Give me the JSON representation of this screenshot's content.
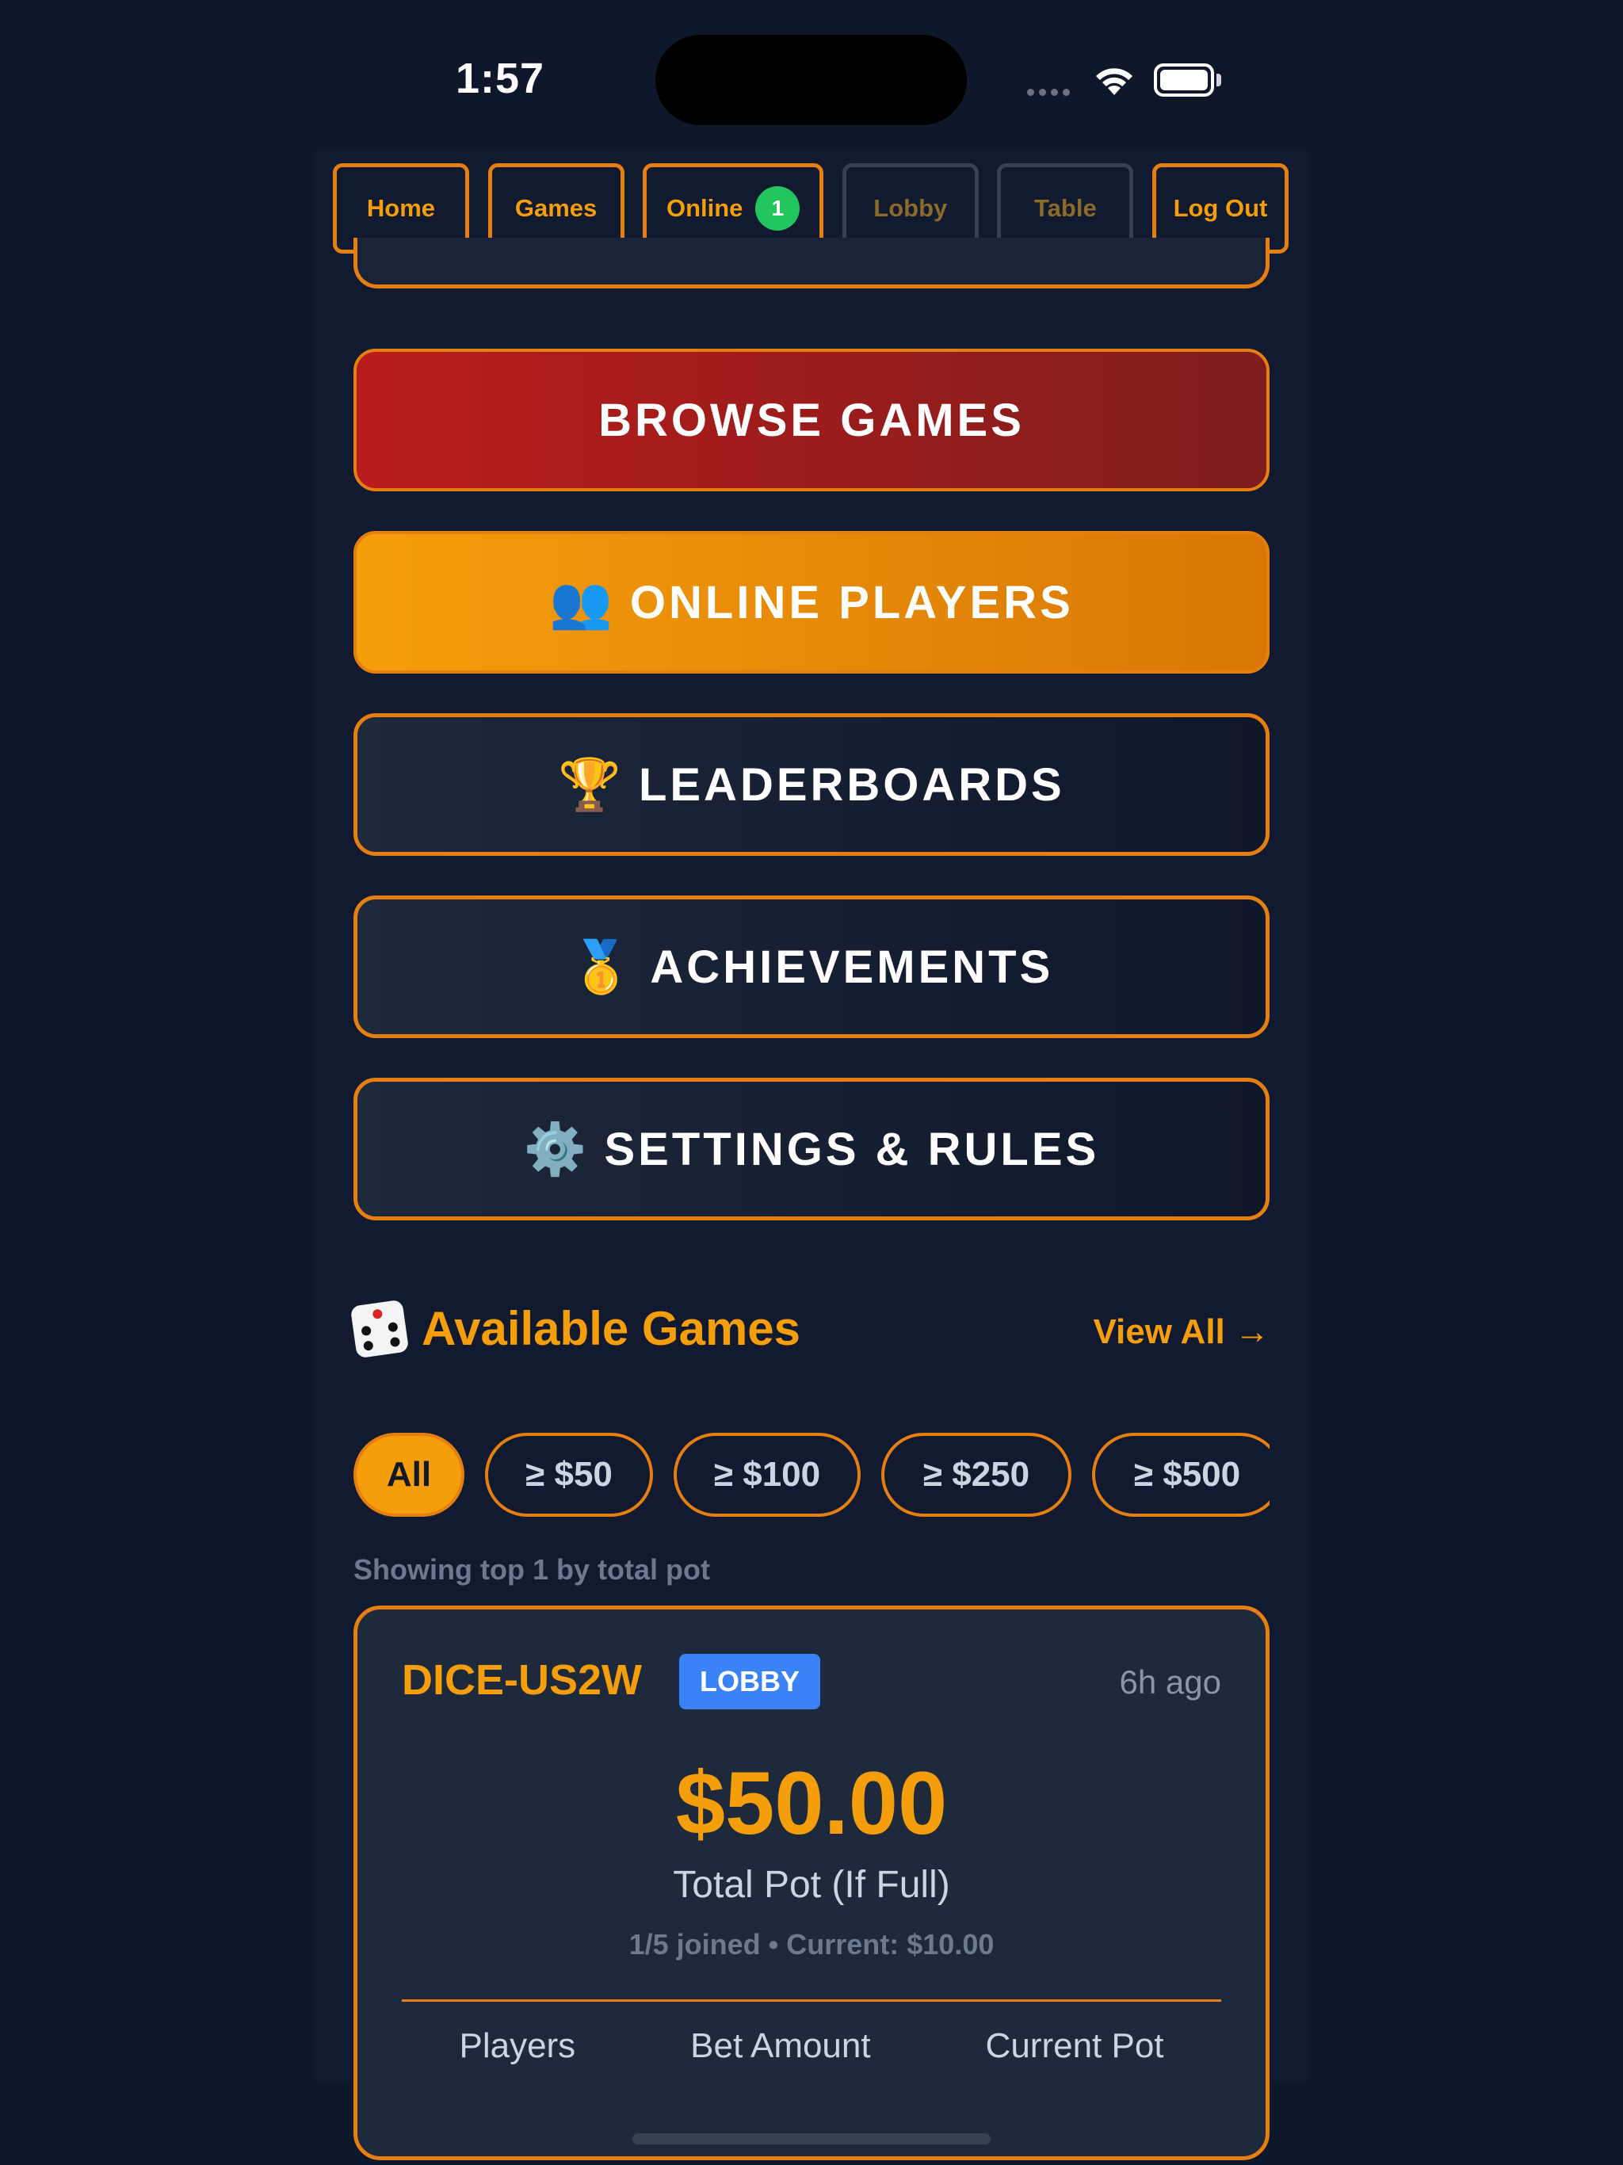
{
  "status": {
    "time": "1:57"
  },
  "nav": {
    "home": "Home",
    "games": "Games",
    "online": "Online",
    "online_badge": "1",
    "lobby": "Lobby",
    "table": "Table",
    "logout": "Log Out"
  },
  "menu": {
    "browse": "BROWSE GAMES",
    "online_players": "ONLINE PLAYERS",
    "leaderboards": "LEADERBOARDS",
    "achievements": "ACHIEVEMENTS",
    "settings": "SETTINGS & RULES",
    "icons": {
      "online_players": "👥",
      "leaderboards": "🏆",
      "achievements": "🥇",
      "settings": "⚙️"
    }
  },
  "available": {
    "title": "Available Games",
    "view_all": "View All →",
    "filters": [
      "All",
      "≥ $50",
      "≥ $100",
      "≥ $250",
      "≥ $500"
    ],
    "active_filter": "All",
    "showing": "Showing top 1 by total pot"
  },
  "game": {
    "id": "DICE-US2W",
    "status": "LOBBY",
    "ago": "6h ago",
    "pot": "$50.00",
    "pot_label": "Total Pot (If Full)",
    "joined": "1/5 joined • Current: $10.00",
    "columns": [
      "Players",
      "Bet Amount",
      "Current Pot"
    ]
  },
  "colors": {
    "accent": "#f59e0b",
    "border": "#e57f12",
    "danger": "#b91c1c",
    "badge": "#22c55e",
    "lobby": "#3b82f6"
  }
}
